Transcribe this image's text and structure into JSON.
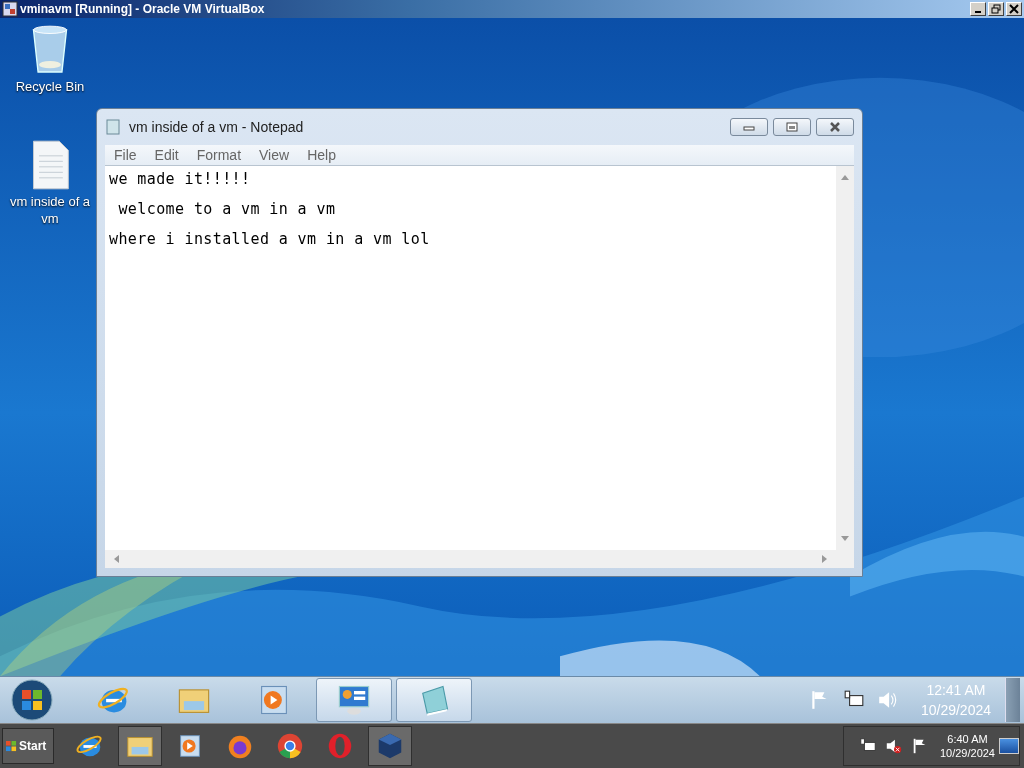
{
  "host_window": {
    "title": "vminavm [Running] - Oracle VM VirtualBox"
  },
  "guest_desktop": {
    "icons": [
      {
        "kind": "recycle-bin",
        "label": "Recycle Bin"
      },
      {
        "kind": "text-file",
        "label": "vm inside of a vm"
      }
    ],
    "notepad": {
      "title": "vm inside of a vm - Notepad",
      "menu": [
        "File",
        "Edit",
        "Format",
        "View",
        "Help"
      ],
      "lines": [
        "we made it!!!!!",
        " welcome to a vm in a vm",
        "where i installed a vm in a vm lol"
      ]
    },
    "taskbar": {
      "pinned": [
        {
          "kind": "browser-e",
          "running": false
        },
        {
          "kind": "folder",
          "running": false
        },
        {
          "kind": "media",
          "running": false
        },
        {
          "kind": "panel",
          "running": true
        },
        {
          "kind": "notepad",
          "running": true
        }
      ],
      "clock": {
        "time": "12:41 AM",
        "date": "10/29/2024"
      }
    }
  },
  "host_taskbar": {
    "start": "Start",
    "apps": [
      {
        "kind": "browser-e",
        "running": false
      },
      {
        "kind": "folder",
        "running": true
      },
      {
        "kind": "media",
        "running": false
      },
      {
        "kind": "fox",
        "running": false
      },
      {
        "kind": "chrome",
        "running": false
      },
      {
        "kind": "opera",
        "running": false
      },
      {
        "kind": "cube",
        "running": true
      }
    ],
    "clock": {
      "time": "6:40 AM",
      "date": "10/29/2024"
    }
  }
}
